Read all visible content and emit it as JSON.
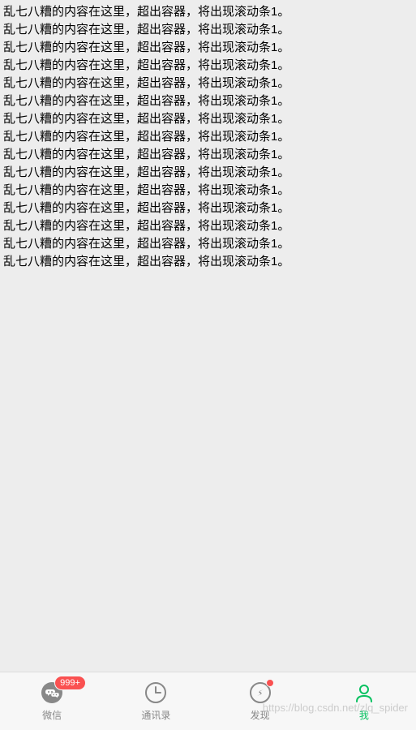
{
  "content": {
    "line_text": "乱七八糟的内容在这里，超出容器，将出现滚动条1。",
    "line_count": 15
  },
  "tabbar": {
    "items": [
      {
        "label": "微信",
        "icon": "chat-icon",
        "badge": "999+",
        "active": false
      },
      {
        "label": "通讯录",
        "icon": "clock-icon",
        "active": false
      },
      {
        "label": "发现",
        "icon": "compass-icon",
        "dot": true,
        "active": false
      },
      {
        "label": "我",
        "icon": "person-icon",
        "active": true
      }
    ]
  },
  "watermark": "https://blog.csdn.net/zlq_spider",
  "colors": {
    "active": "#07c160",
    "inactive": "#888",
    "badge": "#fa5151",
    "background": "#ededed"
  }
}
